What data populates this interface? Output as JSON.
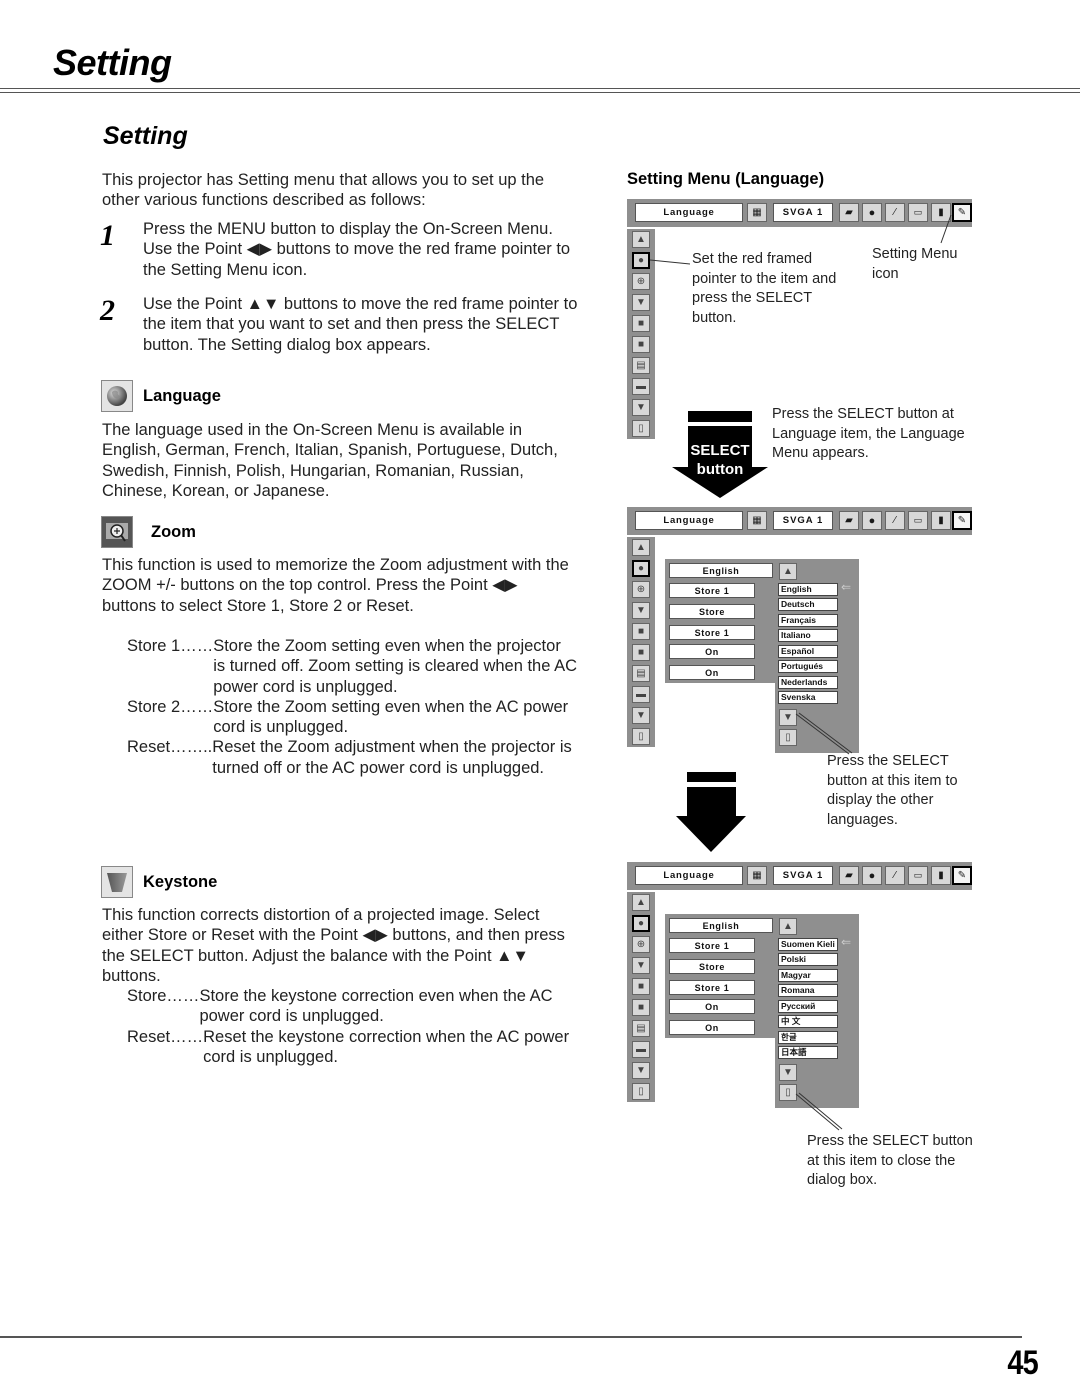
{
  "page": {
    "title": "Setting",
    "section_title": "Setting",
    "page_number": "45"
  },
  "intro": "This projector has Setting menu that allows you to set up the other various functions described as follows:",
  "steps": [
    {
      "number": "1",
      "text": "Press the MENU button to display the On-Screen Menu. Use the Point ◀▶ buttons to move the red frame pointer to the Setting Menu icon."
    },
    {
      "number": "2",
      "text": "Use the Point ▲▼ buttons to move the red frame pointer to the item that you want to set and then press the SELECT button. The Setting dialog box appears."
    }
  ],
  "language": {
    "heading": "Language",
    "icon": "globe-icon",
    "description": "The language used in the On-Screen Menu is available in English, German, French, Italian, Spanish, Portuguese, Dutch, Swedish, Finnish, Polish, Hungarian, Romanian, Russian, Chinese, Korean, or Japanese."
  },
  "zoom": {
    "heading": "Zoom",
    "icon": "zoom-icon",
    "description": "This function is used to memorize the Zoom adjustment with the ZOOM +/- buttons on the top control. Press the Point ◀▶ buttons to select Store 1, Store 2 or Reset.",
    "options": [
      {
        "term": "Store 1……",
        "text": "Store the Zoom setting even when the projector is turned off. Zoom setting is cleared when the AC power cord is unplugged."
      },
      {
        "term": "Store 2……",
        "text": "Store the Zoom setting even when the AC power cord is unplugged."
      },
      {
        "term": "Reset……..",
        "text": "Reset the Zoom adjustment when the projector is turned off or the AC power cord is unplugged."
      }
    ]
  },
  "keystone": {
    "heading": "Keystone",
    "icon": "keystone-icon",
    "description": "This function corrects distortion of a projected image. Select either Store or Reset with the Point ◀▶ buttons, and then press the SELECT button. Adjust the balance with the Point ▲▼ buttons.",
    "options": [
      {
        "term": "Store……",
        "text": "Store the keystone correction even when the AC power cord is unplugged."
      },
      {
        "term": "Reset……",
        "text": "Reset the keystone correction when the AC power cord is unplugged."
      }
    ]
  },
  "setting_menu": {
    "title": "Setting Menu (Language)",
    "osd": {
      "menu_label": "Language",
      "source_label": "SVGA 1",
      "top_icons": [
        "input-icon",
        "pc-adjust-icon",
        "image-select-icon",
        "image-adjust-icon",
        "screen-icon",
        "sound-icon",
        "setting-icon"
      ],
      "side_icons": [
        "up-icon",
        "language-icon",
        "zoom-icon",
        "keystone-icon",
        "background-icon",
        "display-icon",
        "logo-icon",
        "logo-select-icon",
        "down-icon",
        "exit-icon"
      ],
      "panel_values": [
        "English",
        "Store 1",
        "Store",
        "Store 1",
        "On",
        "On"
      ],
      "language_list_1": [
        "English",
        "Deutsch",
        "Français",
        "Italiano",
        "Español",
        "Portugués",
        "Nederlands",
        "Svenska"
      ],
      "language_list_2": [
        "Suomen Kieli",
        "Polski",
        "Magyar",
        "Romana",
        "Русский",
        "中 文",
        "한글",
        "日本語"
      ]
    },
    "callouts": {
      "set_pointer": "Set the red framed pointer to the item and press the SELECT button.",
      "setting_menu_icon": "Setting Menu icon",
      "press_select_language": "Press the SELECT button at Language item, the Language Menu appears.",
      "press_select_other": "Press the SELECT button at this item to display the other languages.",
      "press_select_close": "Press the SELECT button at this item to close the dialog box."
    },
    "select_arrow": {
      "line1": "SELECT",
      "line2": "button"
    }
  }
}
